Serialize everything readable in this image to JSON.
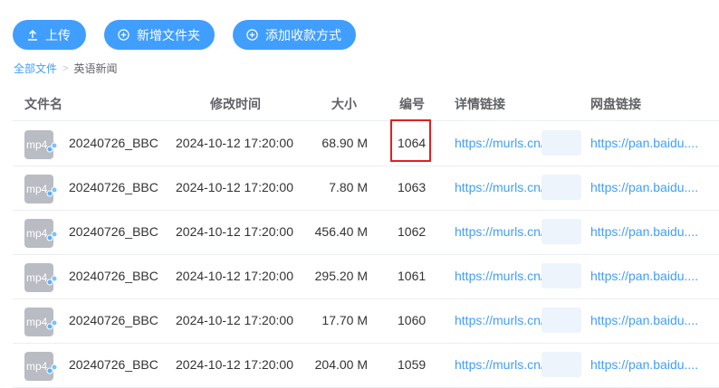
{
  "toolbar": {
    "upload_label": "上传",
    "new_folder_label": "新增文件夹",
    "add_collect_label": "添加收款方式"
  },
  "breadcrumb": {
    "root": "全部文件",
    "separator": ">",
    "current": "英语新闻"
  },
  "table": {
    "columns": {
      "name": "文件名",
      "time": "修改时间",
      "size": "大小",
      "number": "编号",
      "detail": "详情链接",
      "pan": "网盘链接"
    },
    "rows": [
      {
        "icon_text": "mp4",
        "name": "20240726_BBC",
        "time": "2024-10-12 17:20:00",
        "size": "68.90 M",
        "number": "1064",
        "detail": "https://murls.cn/",
        "pan": "https://pan.baidu...."
      },
      {
        "icon_text": "mp4",
        "name": "20240726_BBC",
        "time": "2024-10-12 17:20:00",
        "size": "7.80 M",
        "number": "1063",
        "detail": "https://murls.cn/",
        "pan": "https://pan.baidu...."
      },
      {
        "icon_text": "mp4",
        "name": "20240726_BBC",
        "time": "2024-10-12 17:20:00",
        "size": "456.40 M",
        "number": "1062",
        "detail": "https://murls.cn/",
        "pan": "https://pan.baidu...."
      },
      {
        "icon_text": "mp4",
        "name": "20240726_BBC",
        "time": "2024-10-12 17:20:00",
        "size": "295.20 M",
        "number": "1061",
        "detail": "https://murls.cn/",
        "pan": "https://pan.baidu...."
      },
      {
        "icon_text": "mp4",
        "name": "20240726_BBC",
        "time": "2024-10-12 17:20:00",
        "size": "17.70 M",
        "number": "1060",
        "detail": "https://murls.cn/",
        "pan": "https://pan.baidu...."
      },
      {
        "icon_text": "mp4",
        "name": "20240726_BBC",
        "time": "2024-10-12 17:20:00",
        "size": "204.00 M",
        "number": "1059",
        "detail": "https://murls.cn/",
        "pan": "https://pan.baidu...."
      }
    ]
  },
  "colors": {
    "accent": "#409eff",
    "highlight": "#e02020"
  }
}
